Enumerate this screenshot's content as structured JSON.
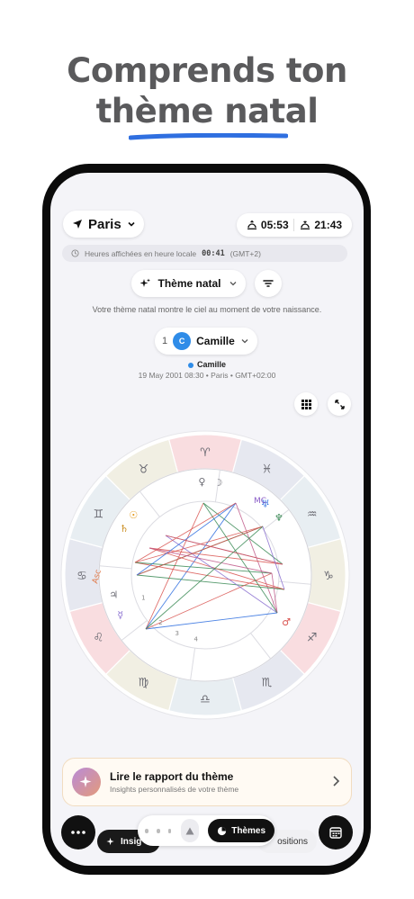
{
  "promo": {
    "line1": "Comprends ton",
    "line2": "thème natal",
    "accent_color": "#2f6fe0"
  },
  "header": {
    "city": "Paris",
    "sunrise": "05:53",
    "sunset": "21:43"
  },
  "notice": {
    "prefix": "Heures affichées en heure locale",
    "time": "00:41",
    "suffix": "(GMT+2)"
  },
  "chart_type": {
    "label": "Thème natal",
    "description": "Votre thème natal montre le ciel au moment de votre naissance."
  },
  "person": {
    "index": "1",
    "initial": "C",
    "name": "Camille",
    "legend_name": "Camille",
    "birth_info": "19 May 2001 08:30 • Paris • GMT+02:00"
  },
  "wheel": {
    "zodiac_glyphs": [
      "♈",
      "♓",
      "♒",
      "♑",
      "♐",
      "♏",
      "♎",
      "♍",
      "♌",
      "♋",
      "♊",
      "♉"
    ],
    "planet_glyphs": [
      "♀",
      "☽",
      "♄",
      "☉",
      "♅",
      "♆",
      "♂",
      "☿",
      "♃"
    ],
    "angle_labels": [
      "MC",
      "Asc"
    ],
    "house_numbers": [
      "1",
      "2",
      "3",
      "4"
    ]
  },
  "report": {
    "title": "Lire le rapport du thème",
    "subtitle": "Insights personnalisés de votre thème"
  },
  "tabs": {
    "insights": "Insig",
    "themes": "Thèmes",
    "positions": "ositions"
  },
  "icons": {
    "location": "location-arrow-icon",
    "sunrise": "sunrise-icon",
    "sunset": "sunset-icon",
    "clock": "clock-icon",
    "sparkle": "sparkle-icon",
    "filter": "filter-icon",
    "grid": "grid-icon",
    "expand": "expand-icon",
    "more": "more-icon",
    "calendar": "calendar-icon"
  }
}
